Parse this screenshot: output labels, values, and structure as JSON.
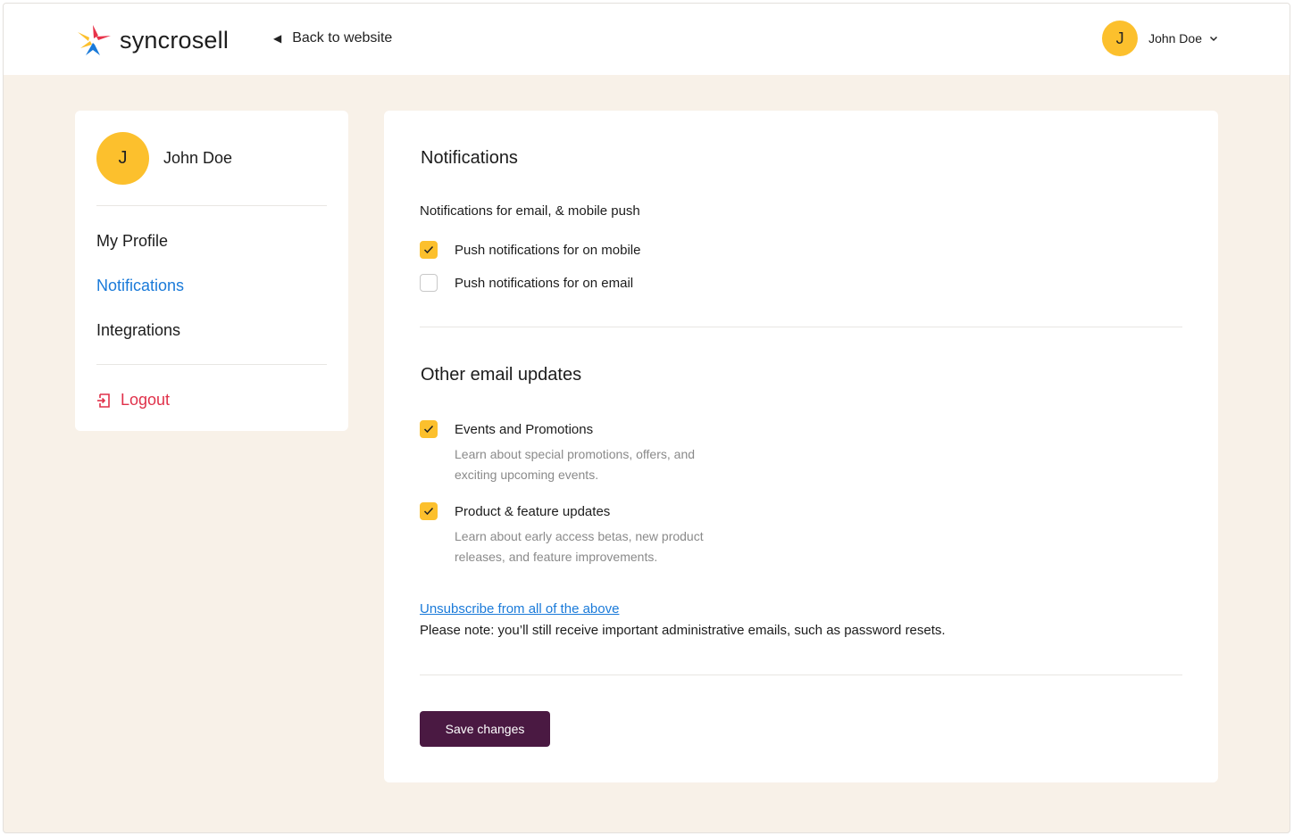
{
  "header": {
    "brand": "syncrosell",
    "back_link": "Back to website",
    "user_initial": "J",
    "user_name": "John Doe"
  },
  "sidebar": {
    "user_initial": "J",
    "user_name": "John Doe",
    "items": [
      {
        "label": "My Profile",
        "active": false
      },
      {
        "label": "Notifications",
        "active": true
      },
      {
        "label": "Integrations",
        "active": false
      }
    ],
    "logout": "Logout"
  },
  "notifications": {
    "title": "Notifications",
    "subtitle": "Notifications for email, & mobile push",
    "options": [
      {
        "label": "Push notifications for on mobile",
        "checked": true
      },
      {
        "label": "Push notifications for on email",
        "checked": false
      }
    ]
  },
  "email_updates": {
    "title": "Other email updates",
    "options": [
      {
        "label": "Events and Promotions",
        "checked": true,
        "description": "Learn about special promotions, offers, and exciting upcoming events."
      },
      {
        "label": "Product & feature updates",
        "checked": true,
        "description": "Learn about early access betas, new product releases, and feature improvements."
      }
    ],
    "unsubscribe": "Unsubscribe from all of the above",
    "note": "Please note: you’ll still receive important administrative emails, such as password resets."
  },
  "actions": {
    "save": "Save changes"
  },
  "colors": {
    "accent": "#fcc02d",
    "link": "#1a7ad9",
    "danger": "#e0314a",
    "primary_button": "#4a1942",
    "page_bg": "#f8f1e8"
  }
}
